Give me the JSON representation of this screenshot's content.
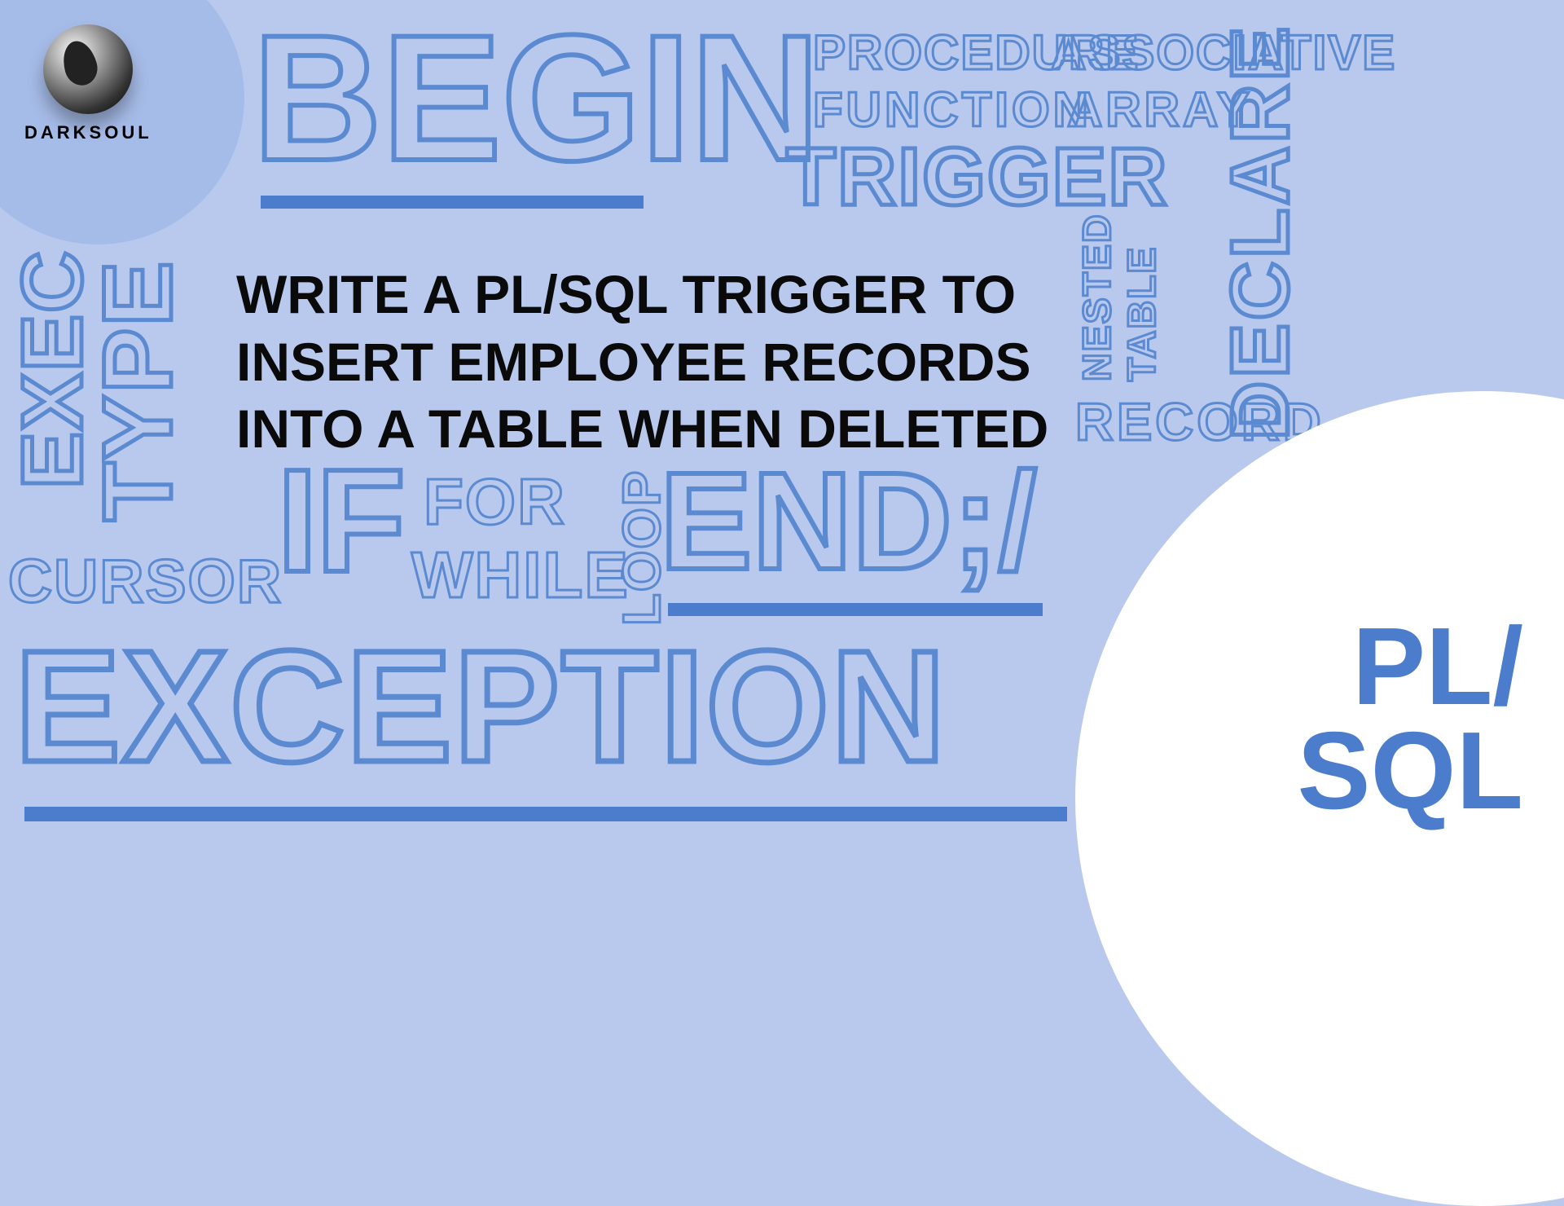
{
  "logo": {
    "text": "DARKSOUL"
  },
  "words": {
    "begin": "BEGIN",
    "procedure": "PROCEDURE",
    "function": "FUNCTION",
    "associative": "ASSOCIATIVE",
    "array": "ARRAY",
    "trigger": "TRIGGER",
    "declare": "DECLARE",
    "nested": "NESTED",
    "table": "TABLE",
    "record": "RECORD",
    "exec": "EXEC",
    "type": "TYPE",
    "cursor": "CURSOR",
    "if": "IF",
    "for": "FOR",
    "while": "WHILE",
    "loop": "LOOP",
    "end": "END;/",
    "exception": "EXCEPTION"
  },
  "corner": {
    "line1": "PL/",
    "line2": "SQL"
  },
  "title": "WRITE A PL/SQL TRIGGER TO INSERT EMPLOYEE RECORDS INTO A TABLE WHEN DELETED"
}
